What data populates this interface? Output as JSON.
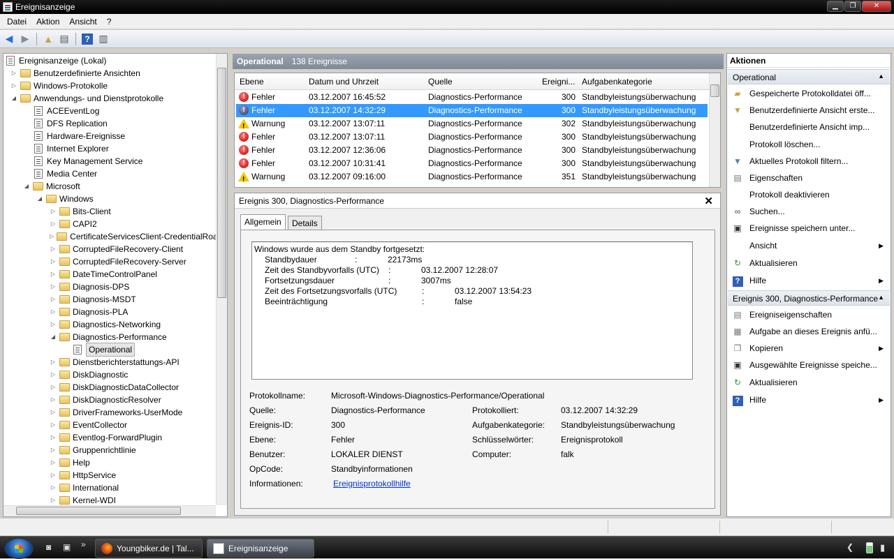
{
  "window": {
    "title": "Ereignisanzeige"
  },
  "menubar": {
    "items": [
      "Datei",
      "Aktion",
      "Ansicht",
      "?"
    ]
  },
  "tree": {
    "root": "Ereignisanzeige (Lokal)",
    "rows": [
      {
        "label": "Benutzerdefinierte Ansichten"
      },
      {
        "label": "Windows-Protokolle"
      },
      {
        "label": "Anwendungs- und Dienstprotokolle"
      },
      {
        "label": "ACEEventLog"
      },
      {
        "label": "DFS Replication"
      },
      {
        "label": "Hardware-Ereignisse"
      },
      {
        "label": "Internet Explorer"
      },
      {
        "label": "Key Management Service"
      },
      {
        "label": "Media Center"
      },
      {
        "label": "Microsoft"
      },
      {
        "label": "Windows"
      },
      {
        "label": "Bits-Client"
      },
      {
        "label": "CAPI2"
      },
      {
        "label": "CertificateServicesClient-CredentialRoa"
      },
      {
        "label": "CorruptedFileRecovery-Client"
      },
      {
        "label": "CorruptedFileRecovery-Server"
      },
      {
        "label": "DateTimeControlPanel"
      },
      {
        "label": "Diagnosis-DPS"
      },
      {
        "label": "Diagnosis-MSDT"
      },
      {
        "label": "Diagnosis-PLA"
      },
      {
        "label": "Diagnostics-Networking"
      },
      {
        "label": "Diagnostics-Performance"
      },
      {
        "label": "Operational"
      },
      {
        "label": "Dienstberichterstattungs-API"
      },
      {
        "label": "DiskDiagnostic"
      },
      {
        "label": "DiskDiagnosticDataCollector"
      },
      {
        "label": "DiskDiagnosticResolver"
      },
      {
        "label": "DriverFrameworks-UserMode"
      },
      {
        "label": "EventCollector"
      },
      {
        "label": "Eventlog-ForwardPlugin"
      },
      {
        "label": "Gruppenrichtlinie"
      },
      {
        "label": "Help"
      },
      {
        "label": "HttpService"
      },
      {
        "label": "International"
      },
      {
        "label": "Kernel-WDI"
      }
    ]
  },
  "center": {
    "header_title": "Operational",
    "header_count": "138 Ereignisse",
    "columns": [
      "Ebene",
      "Datum und Uhrzeit",
      "Quelle",
      "Ereigni...",
      "Aufgabenkategorie"
    ],
    "rows": [
      {
        "level": "Fehler",
        "date": "03.12.2007 16:45:52",
        "source": "Diagnostics-Performance",
        "id": "300",
        "category": "Standbyleistungsüberwachung"
      },
      {
        "level": "Fehler",
        "date": "03.12.2007 14:32:29",
        "source": "Diagnostics-Performance",
        "id": "300",
        "category": "Standbyleistungsüberwachung"
      },
      {
        "level": "Warnung",
        "date": "03.12.2007 13:07:11",
        "source": "Diagnostics-Performance",
        "id": "302",
        "category": "Standbyleistungsüberwachung"
      },
      {
        "level": "Fehler",
        "date": "03.12.2007 13:07:11",
        "source": "Diagnostics-Performance",
        "id": "300",
        "category": "Standbyleistungsüberwachung"
      },
      {
        "level": "Fehler",
        "date": "03.12.2007 12:36:06",
        "source": "Diagnostics-Performance",
        "id": "300",
        "category": "Standbyleistungsüberwachung"
      },
      {
        "level": "Fehler",
        "date": "03.12.2007 10:31:41",
        "source": "Diagnostics-Performance",
        "id": "300",
        "category": "Standbyleistungsüberwachung"
      },
      {
        "level": "Warnung",
        "date": "03.12.2007 09:16:00",
        "source": "Diagnostics-Performance",
        "id": "351",
        "category": "Standbyleistungsüberwachung"
      }
    ]
  },
  "detail": {
    "title": "Ereignis 300, Diagnostics-Performance",
    "tabs": [
      "Allgemein",
      "Details"
    ],
    "message": {
      "line1": "Windows wurde aus dem Standby fortgesetzt:",
      "rows": [
        {
          "k": "Standbydauer",
          "sep": ":",
          "v": "22173ms"
        },
        {
          "k": "Zeit des Standbyvorfalls (UTC)",
          "sep": ":",
          "v": "03.12.2007 12:28:07"
        },
        {
          "k": "Fortsetzungsdauer",
          "sep": ":",
          "v": "3007ms"
        },
        {
          "k": "Zeit des Fortsetzungsvorfalls (UTC)",
          "sep": ":",
          "v": "03.12.2007 13:54:23"
        },
        {
          "k": "Beeinträchtigung",
          "sep": ":",
          "v": "false"
        }
      ]
    },
    "fields": {
      "logname_label": "Protokollname:",
      "logname": "Microsoft-Windows-Diagnostics-Performance/Operational",
      "source_label": "Quelle:",
      "source": "Diagnostics-Performance",
      "logged_label": "Protokolliert:",
      "logged": "03.12.2007 14:32:29",
      "eventid_label": "Ereignis-ID:",
      "eventid": "300",
      "taskcat_label": "Aufgabenkategorie:",
      "taskcat": "Standbyleistungsüberwachung",
      "level_label": "Ebene:",
      "level": "Fehler",
      "keywords_label": "Schlüsselwörter:",
      "keywords": "Ereignisprotokoll",
      "user_label": "Benutzer:",
      "user": "LOKALER DIENST",
      "computer_label": "Computer:",
      "computer": "falk",
      "opcode_label": "OpCode:",
      "opcode": "Standbyinformationen",
      "info_label": "Informationen:",
      "info_link": "Ereignisprotokollhilfe"
    }
  },
  "actions": {
    "title": "Aktionen",
    "section1": "Operational",
    "items1": [
      "Gespeicherte Protokolldatei öff...",
      "Benutzerdefinierte Ansicht erste...",
      "Benutzerdefinierte Ansicht imp...",
      "Protokoll löschen...",
      "Aktuelles Protokoll filtern...",
      "Eigenschaften",
      "Protokoll deaktivieren",
      "Suchen...",
      "Ereignisse speichern unter...",
      "Ansicht",
      "Aktualisieren",
      "Hilfe"
    ],
    "section2": "Ereignis 300, Diagnostics-Performance",
    "items2": [
      "Ereigniseigenschaften",
      "Aufgabe an dieses Ereignis anfü...",
      "Kopieren",
      "Ausgewählte Ereignisse speiche...",
      "Aktualisieren",
      "Hilfe"
    ]
  },
  "taskbar": {
    "tasks": [
      "Youngbiker.de | Tal...",
      "Ereignisanzeige"
    ],
    "quicklaunch_more": "»"
  },
  "colors": {
    "selection": "#3399ff",
    "header_bar": "#8c96a2",
    "link": "#0033cc"
  }
}
